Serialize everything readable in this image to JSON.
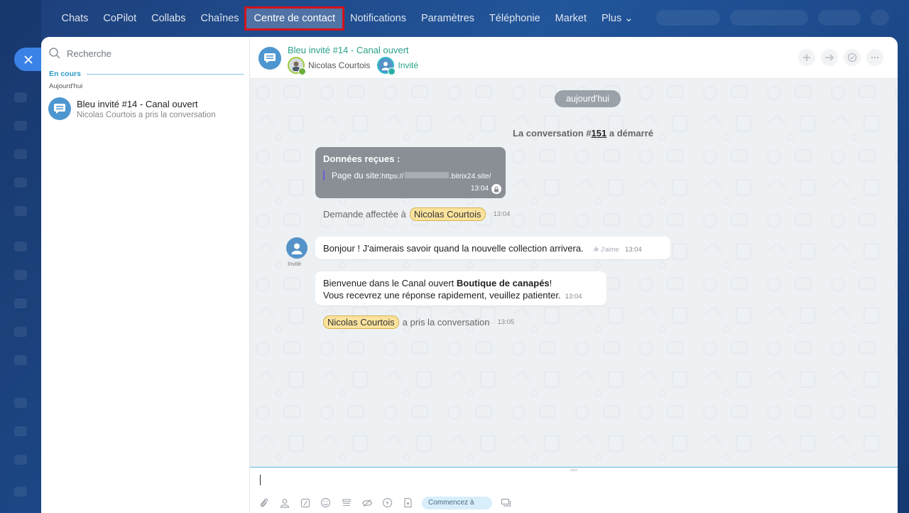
{
  "nav": {
    "items": [
      "Chats",
      "CoPilot",
      "Collabs",
      "Chaînes",
      "Centre de contact",
      "Notifications",
      "Paramètres",
      "Téléphonie",
      "Market",
      "Plus ⌄"
    ],
    "active_index": 4,
    "active_highlight_color": "#d3121c"
  },
  "sidebar": {
    "search_placeholder": "Recherche",
    "section_title": "En cours",
    "day_label": "Aujourd'hui",
    "chat": {
      "title": "Bleu invité #14 - Canal ouvert",
      "subtitle": "Nicolas Courtois a pris la conversation"
    }
  },
  "header": {
    "title": "Bleu invité #14 - Canal ouvert",
    "user_name": "Nicolas Courtois",
    "guest_label": "Invité",
    "actions": [
      "add-user",
      "forward",
      "finish",
      "more"
    ]
  },
  "messages": {
    "date_pill": "aujourd'hui",
    "system_prefix": "La conversation #",
    "system_number": "151",
    "system_suffix": " a démarré",
    "data_card": {
      "title": "Données reçues :",
      "label": "Page du site:",
      "url_prefix": "https://",
      "url_suffix": ".bitrix24.site/",
      "time": "13:04"
    },
    "assign": {
      "text": "Demande affectée à",
      "name": "Nicolas Courtois",
      "time": "13:04"
    },
    "guest_label": "Invité",
    "bubble1": {
      "text": "Bonjour ! J'aimerais savoir quand la nouvelle collection arrivera.",
      "like": "J'aime",
      "time": "13:04"
    },
    "bubble2": {
      "line1_prefix": "Bienvenue dans le Canal ouvert ",
      "line1_bold": "Boutique de canapés",
      "line1_suffix": "!",
      "line2": "Vous recevrez une réponse rapidement, veuillez patienter.",
      "time": "13:04"
    },
    "take": {
      "name": "Nicolas Courtois",
      "text": "a pris la conversation",
      "time": "13:05"
    }
  },
  "composer": {
    "quick_button": "Commencez à"
  },
  "colors": {
    "accent": "#2aa089",
    "blue": "#3b82e6",
    "section": "#2a9ac6"
  }
}
